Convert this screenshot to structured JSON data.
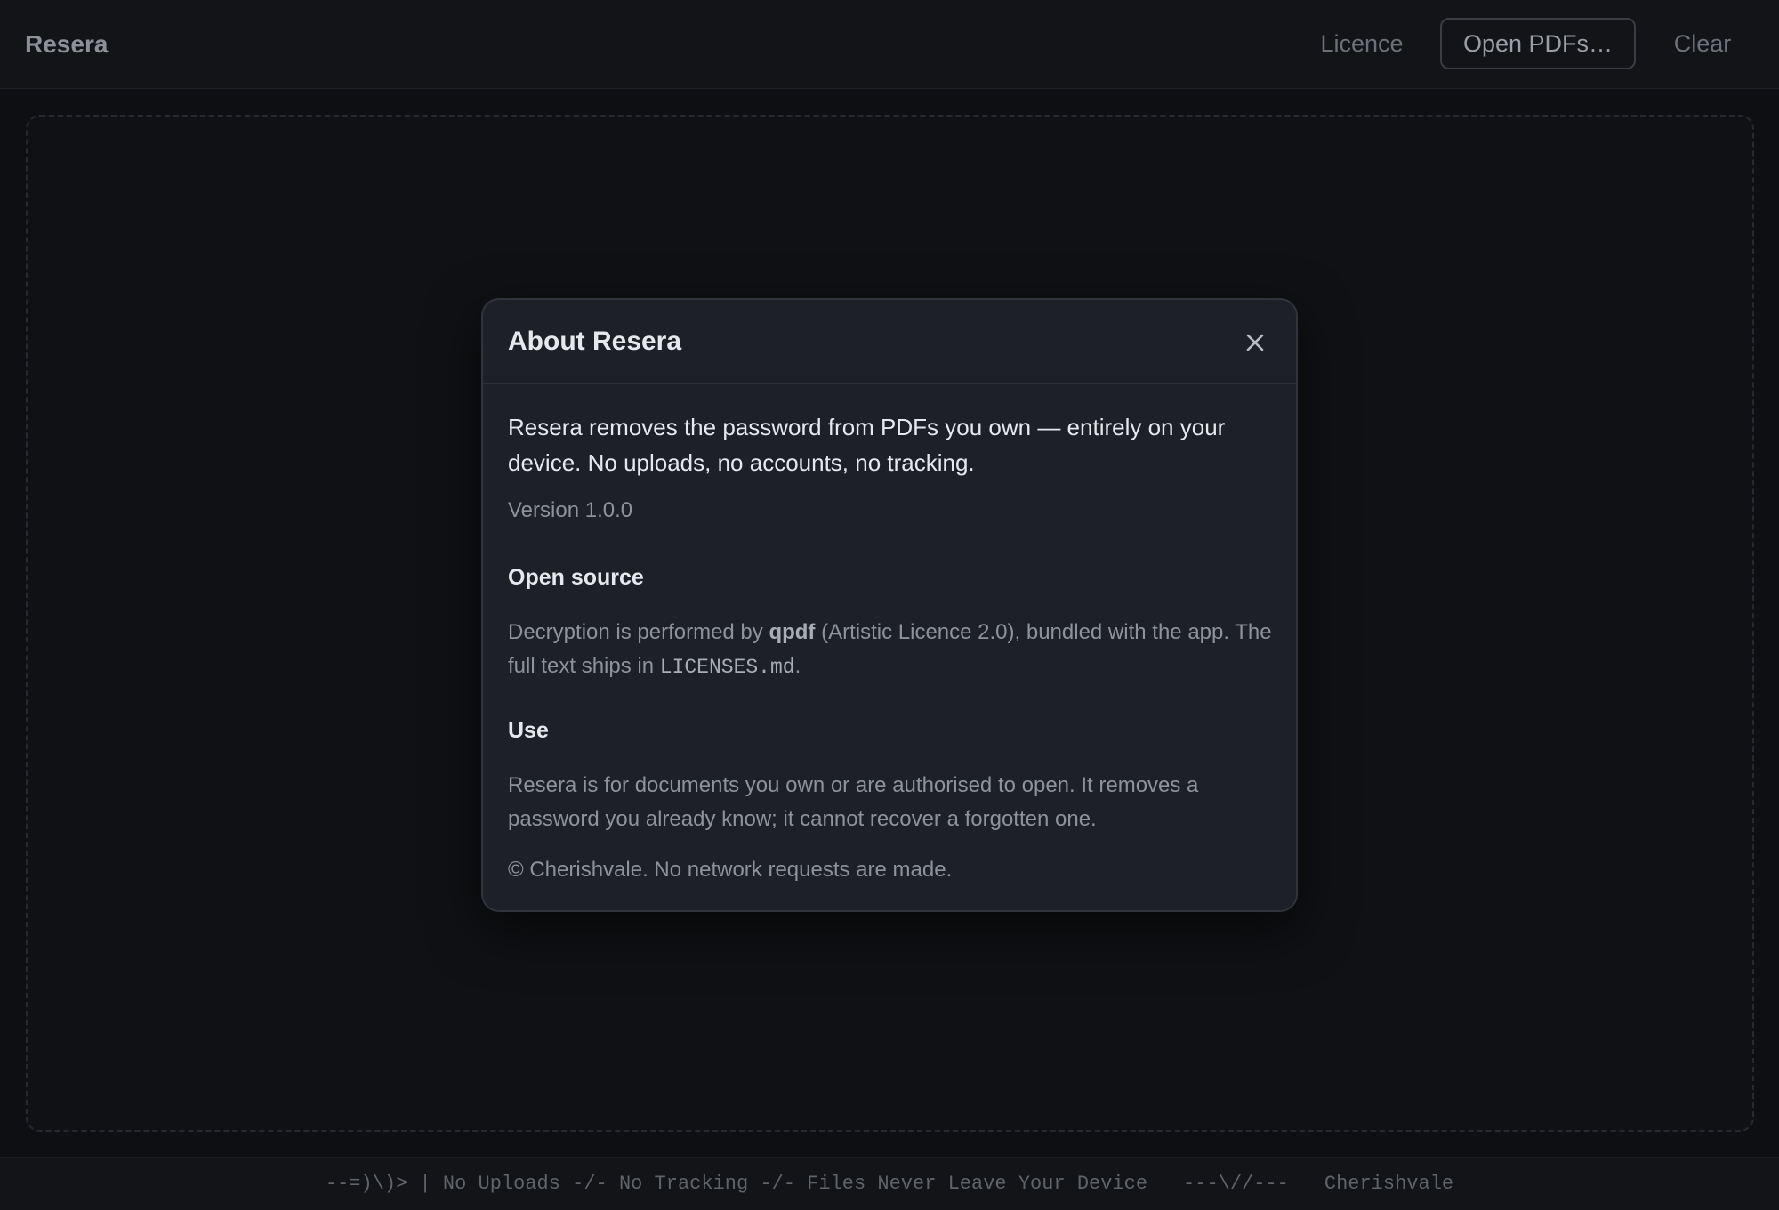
{
  "app": {
    "name": "Resera"
  },
  "toolbar": {
    "licence_label": "Licence",
    "open_label": "Open PDFs…",
    "clear_label": "Clear"
  },
  "modal": {
    "title": "About Resera",
    "close_icon": "close-icon",
    "intro": "Resera removes the password from PDFs you own — entirely on your device. No uploads, no accounts, no tracking.",
    "version": "Version 1.0.0",
    "open_source": {
      "heading": "Open source",
      "text_before": "Decryption is performed by ",
      "library": "qpdf",
      "text_after": " (Artistic Licence 2.0), bundled with the app. The full text ships in ",
      "file": "LICENSES.md",
      "text_end": "."
    },
    "use": {
      "heading": "Use",
      "text": "Resera is for documents you own or are authorised to open. It removes a password you already know; it cannot recover a forgotten one."
    },
    "copyright": "© Cherishvale. No network requests are made."
  },
  "statusbar": {
    "tagline": "--=)\\)> | No Uploads -/- No Tracking -/- Files Never Leave Your Device",
    "divider": "---\\//---",
    "author": "Cherishvale"
  },
  "colors": {
    "background": "#0d0f12",
    "modal_bg": "#1e2027",
    "text_primary": "#e6e8ec",
    "text_muted": "#8e929a"
  }
}
